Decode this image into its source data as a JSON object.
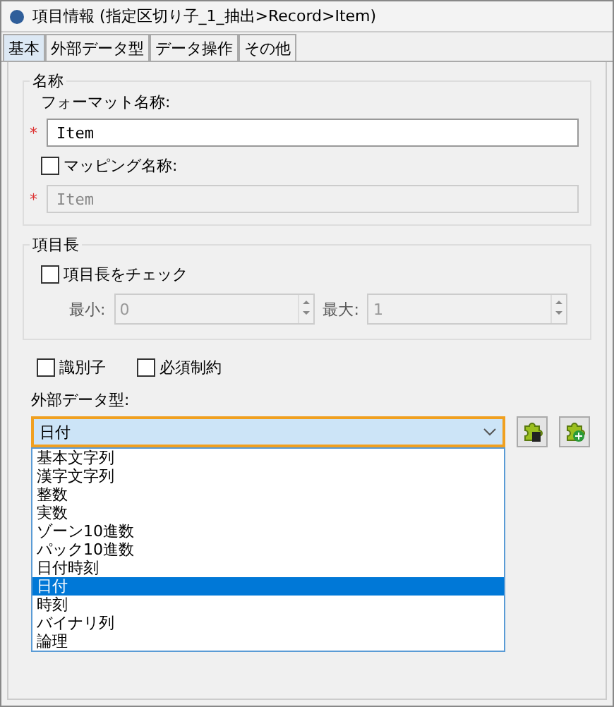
{
  "window": {
    "title": "項目情報 (指定区切り子_1_抽出>Record>Item)"
  },
  "tabs": [
    {
      "label": "基本",
      "selected": true
    },
    {
      "label": "外部データ型",
      "selected": false
    },
    {
      "label": "データ操作",
      "selected": false
    },
    {
      "label": "その他",
      "selected": false
    }
  ],
  "name_group": {
    "title": "名称",
    "format_label": "フォーマット名称:",
    "format_required_mark": "*",
    "format_value": "Item",
    "mapping_checkbox": {
      "label": "マッピング名称:",
      "checked": false
    },
    "mapping_required_mark": "*",
    "mapping_value": "Item",
    "mapping_disabled": true
  },
  "length_group": {
    "title": "項目長",
    "check": {
      "label": "項目長をチェック",
      "checked": false
    },
    "min_label": "最小:",
    "min_value": "0",
    "max_label": "最大:",
    "max_value": "1",
    "disabled": true
  },
  "flags": [
    {
      "label": "識別子",
      "checked": false
    },
    {
      "label": "必須制約",
      "checked": false
    }
  ],
  "external_type": {
    "label": "外部データ型:",
    "value": "日付",
    "expanded": true,
    "options": [
      {
        "label": "基本文字列",
        "selected": false
      },
      {
        "label": "漢字文字列",
        "selected": false
      },
      {
        "label": "整数",
        "selected": false
      },
      {
        "label": "実数",
        "selected": false
      },
      {
        "label": "ゾーン10進数",
        "selected": false
      },
      {
        "label": "パック10進数",
        "selected": false
      },
      {
        "label": "日付時刻",
        "selected": false
      },
      {
        "label": "日付",
        "selected": true
      },
      {
        "label": "時刻",
        "selected": false
      },
      {
        "label": "バイナリ列",
        "selected": false
      },
      {
        "label": "論理",
        "selected": false
      }
    ]
  }
}
